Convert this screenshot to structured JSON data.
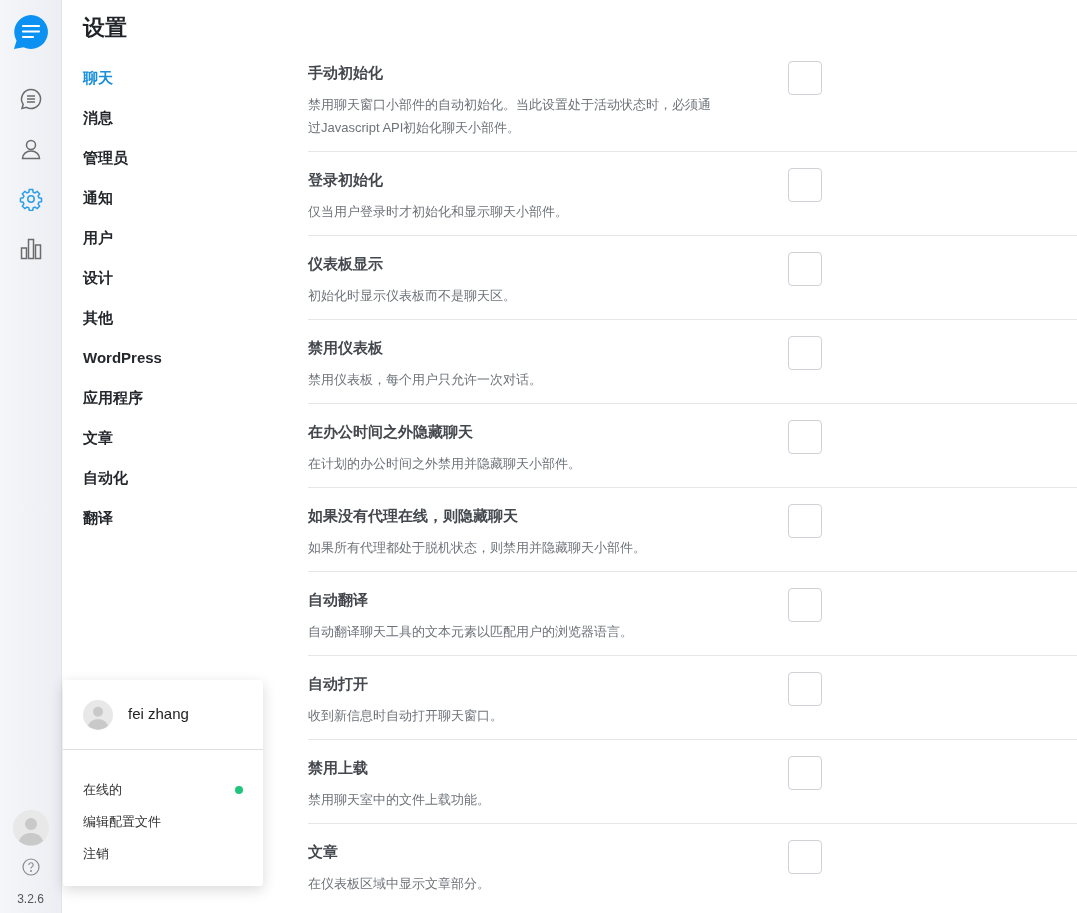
{
  "rail": {
    "items": [
      {
        "kind": "chat",
        "selected": false
      },
      {
        "kind": "user",
        "selected": false
      },
      {
        "kind": "settings",
        "selected": true
      },
      {
        "kind": "reports",
        "selected": false
      }
    ],
    "version": "3.2.6"
  },
  "title": "设置",
  "nav": [
    {
      "label": "聊天",
      "selected": true
    },
    {
      "label": "消息",
      "selected": false
    },
    {
      "label": "管理员",
      "selected": false
    },
    {
      "label": "通知",
      "selected": false
    },
    {
      "label": "用户",
      "selected": false
    },
    {
      "label": "设计",
      "selected": false
    },
    {
      "label": "其他",
      "selected": false
    },
    {
      "label": "WordPress",
      "selected": false
    },
    {
      "label": "应用程序",
      "selected": false
    },
    {
      "label": "文章",
      "selected": false
    },
    {
      "label": "自动化",
      "selected": false
    },
    {
      "label": "翻译",
      "selected": false
    }
  ],
  "settings": [
    {
      "title": "手动初始化",
      "description": "禁用聊天窗口小部件的自动初始化。当此设置处于活动状态时，必须通过Javascript API初始化聊天小部件。",
      "checked": false
    },
    {
      "title": "登录初始化",
      "description": "仅当用户登录时才初始化和显示聊天小部件。",
      "checked": false
    },
    {
      "title": "仪表板显示",
      "description": "初始化时显示仪表板而不是聊天区。",
      "checked": false
    },
    {
      "title": "禁用仪表板",
      "description": "禁用仪表板，每个用户只允许一次对话。",
      "checked": false
    },
    {
      "title": "在办公时间之外隐藏聊天",
      "description": "在计划的办公时间之外禁用并隐藏聊天小部件。",
      "checked": false
    },
    {
      "title": "如果没有代理在线，则隐藏聊天",
      "description": "如果所有代理都处于脱机状态，则禁用并隐藏聊天小部件。",
      "checked": false
    },
    {
      "title": "自动翻译",
      "description": "自动翻译聊天工具的文本元素以匹配用户的浏览器语言。",
      "checked": false
    },
    {
      "title": "自动打开",
      "description": "收到新信息时自动打开聊天窗口。",
      "checked": false
    },
    {
      "title": "禁用上载",
      "description": "禁用聊天室中的文件上载功能。",
      "checked": false
    },
    {
      "title": "文章",
      "description": "在仪表板区域中显示文章部分。",
      "checked": false
    }
  ],
  "profile_menu": {
    "name": "fei zhang",
    "items": [
      {
        "label": "在线的",
        "kind": "status",
        "color": "#1fc57a"
      },
      {
        "label": "编辑配置文件",
        "kind": "link"
      },
      {
        "label": "注销",
        "kind": "link"
      }
    ]
  }
}
